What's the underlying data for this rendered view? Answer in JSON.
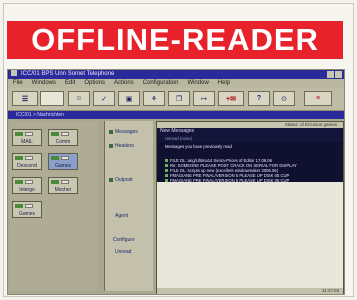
{
  "banner": {
    "title": "OFFLINE-READER"
  },
  "app": {
    "title": "ICC/01 BPS Unn Somet Telephone"
  },
  "menu": [
    "File",
    "Windows",
    "Edit",
    "Options",
    "Actions",
    "Configuration",
    "Window",
    "Help"
  ],
  "toolbar": {
    "buttons": [
      "☰",
      "",
      "☺",
      "✓",
      "▣",
      "⚘",
      "❐",
      "↦",
      "+✉",
      "?",
      "⊙",
      "≡"
    ]
  },
  "document": {
    "title": "ICC/01 > Nachrichten"
  },
  "groups": [
    {
      "label": "MAIL"
    },
    {
      "label": "Comm"
    },
    {
      "label": "Descend"
    },
    {
      "label": "Games"
    },
    {
      "label": "Intergo"
    },
    {
      "label": "Mecher"
    },
    {
      "label": "Games"
    }
  ],
  "actions": [
    "Messages",
    "Headers",
    "Outpost",
    "Agent",
    "Configure",
    "Unread"
  ],
  "panel": {
    "header": "Status: of Ericsson games",
    "tab1": "New Messages",
    "tab2": "Unread (none)",
    "tab3": "Messages you have previously read"
  },
  "messages": [
    "FILE DL: ang/Ultima14 Sierra-Prices of Editor 17.06.06",
    "Re: SOMEONE PLEASE POST CRACK ON SERIAL FOR DISPLAY",
    "FILE DL: scripts up new (excellent windowmaker 2006.06)",
    "FMAGIANE PRE FINAL/VERSION 5 PLEASE UP DISK 05 CUP",
    "FMAGIANE PRE FINAL/VERSION 5 PLEASE UP DISK 05 CUP"
  ],
  "status": "11:17:03"
}
